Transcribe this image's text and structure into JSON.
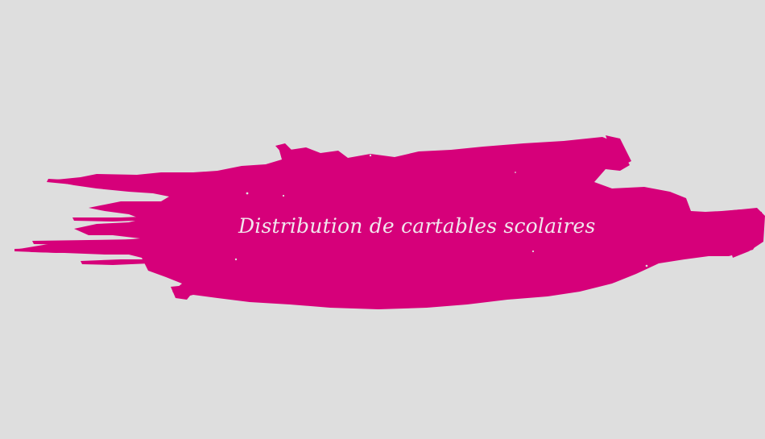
{
  "banner": {
    "title": "Distribution de cartables scolaires"
  },
  "colors": {
    "background": "#dedede",
    "brush": "#d6007a",
    "text": "#f2e6ee"
  },
  "icons": {
    "brush_stroke": "paint-brush-stroke-icon"
  }
}
